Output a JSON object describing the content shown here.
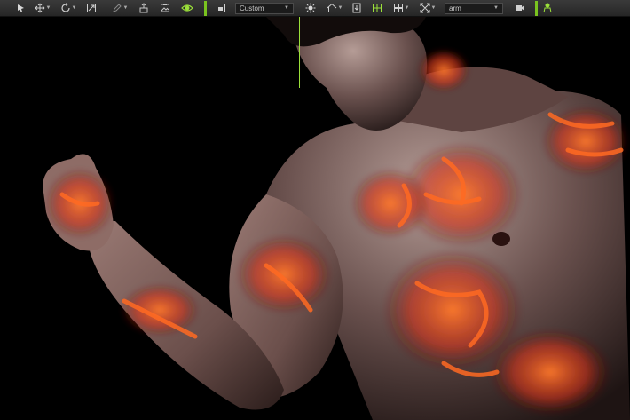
{
  "toolbar": {
    "render_preset": "Custom",
    "unit_select": "arm",
    "icons": [
      "select-arrow-icon",
      "move-icon",
      "rotate-icon",
      "scale-icon",
      "edit-icon",
      "pose-icon",
      "snapshot-icon",
      "visibility-eye-icon",
      "frame-icon",
      "light-icon",
      "home-icon",
      "info-icon",
      "grid-icon",
      "layout-icon",
      "pin-icon",
      "camera-icon",
      "avatar-icon"
    ]
  },
  "viewport": {
    "background": "#000000",
    "accent": "#7ac31f"
  }
}
